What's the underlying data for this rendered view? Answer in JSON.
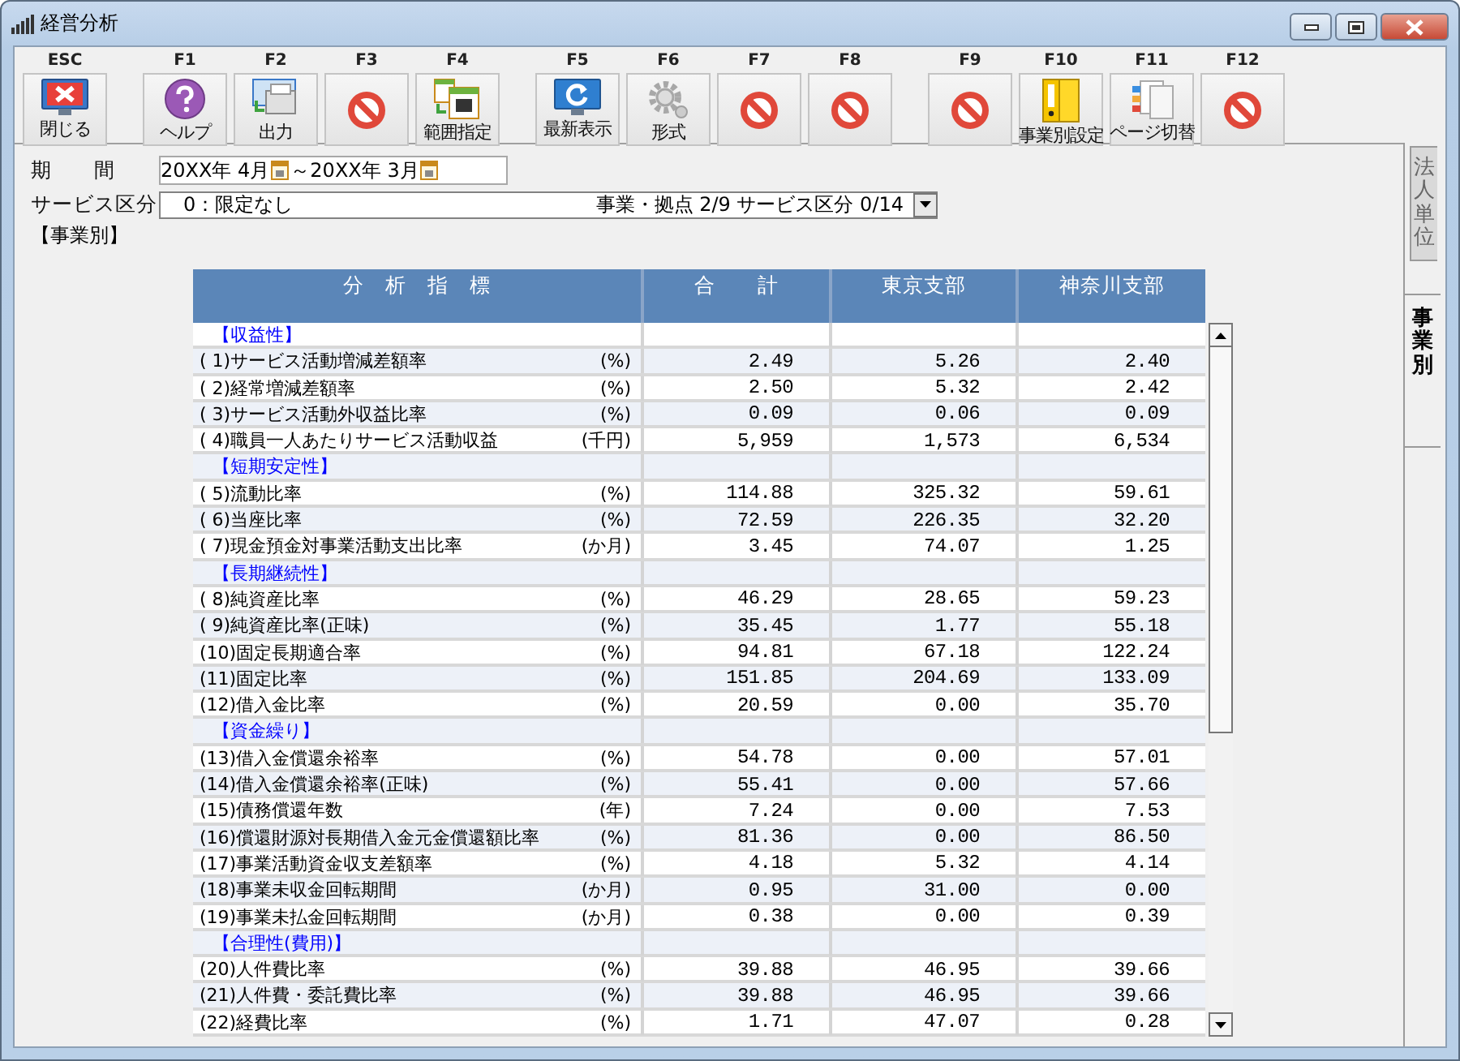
{
  "window": {
    "title": "経営分析"
  },
  "toolbar_groups": [
    [
      {
        "key": "ESC",
        "label": "閉じる",
        "kind": "close"
      }
    ],
    [
      {
        "key": "F1",
        "label": "ヘルプ",
        "kind": "help"
      },
      {
        "key": "F2",
        "label": "出力",
        "kind": "output"
      },
      {
        "key": "F3",
        "kind": "unavailable"
      },
      {
        "key": "F4",
        "label": "範囲指定",
        "kind": "range"
      }
    ],
    [
      {
        "key": "F5",
        "label": "最新表示",
        "kind": "refresh"
      },
      {
        "key": "F6",
        "label": "形式",
        "kind": "format"
      },
      {
        "key": "F7",
        "kind": "unavailable"
      },
      {
        "key": "F8",
        "kind": "unavailable"
      }
    ],
    [
      {
        "key": "F9",
        "kind": "unavailable"
      },
      {
        "key": "F10",
        "label": "事業別設定",
        "kind": "binder"
      },
      {
        "key": "F11",
        "label": "ページ切替",
        "kind": "pages"
      },
      {
        "key": "F12",
        "kind": "unavailable"
      }
    ]
  ],
  "period": {
    "label": "期　　間",
    "from": "20XX年 4月",
    "separator": "～",
    "to": "20XX年 3月"
  },
  "service": {
    "label": "サービス区分",
    "value": "0：限定なし",
    "summary": "事業・拠点 2/9 サービス区分 0/14"
  },
  "section_label": "【事業別】",
  "table": {
    "columns": [
      "分　析　指　標",
      "合　　計",
      "東京支部",
      "神奈川支部"
    ],
    "rows": [
      {
        "kind": "category",
        "label": "【収益性】"
      },
      {
        "kind": "metric",
        "label": "( 1)サービス活動増減差額率",
        "unit": "(%)",
        "values": [
          "2.49",
          "5.26",
          "2.40"
        ]
      },
      {
        "kind": "metric",
        "label": "( 2)経常増減差額率",
        "unit": "(%)",
        "values": [
          "2.50",
          "5.32",
          "2.42"
        ]
      },
      {
        "kind": "metric",
        "label": "( 3)サービス活動外収益比率",
        "unit": "(%)",
        "values": [
          "0.09",
          "0.06",
          "0.09"
        ]
      },
      {
        "kind": "metric",
        "label": "( 4)職員一人あたりサービス活動収益",
        "unit": "(千円)",
        "values": [
          "5,959",
          "1,573",
          "6,534"
        ]
      },
      {
        "kind": "category",
        "label": "【短期安定性】"
      },
      {
        "kind": "metric",
        "label": "( 5)流動比率",
        "unit": "(%)",
        "values": [
          "114.88",
          "325.32",
          "59.61"
        ]
      },
      {
        "kind": "metric",
        "label": "( 6)当座比率",
        "unit": "(%)",
        "values": [
          "72.59",
          "226.35",
          "32.20"
        ]
      },
      {
        "kind": "metric",
        "label": "( 7)現金預金対事業活動支出比率",
        "unit": "(か月)",
        "values": [
          "3.45",
          "74.07",
          "1.25"
        ]
      },
      {
        "kind": "category",
        "label": "【長期継続性】"
      },
      {
        "kind": "metric",
        "label": "( 8)純資産比率",
        "unit": "(%)",
        "values": [
          "46.29",
          "28.65",
          "59.23"
        ]
      },
      {
        "kind": "metric",
        "label": "( 9)純資産比率(正味)",
        "unit": "(%)",
        "values": [
          "35.45",
          "1.77",
          "55.18"
        ]
      },
      {
        "kind": "metric",
        "label": "(10)固定長期適合率",
        "unit": "(%)",
        "values": [
          "94.81",
          "67.18",
          "122.24"
        ]
      },
      {
        "kind": "metric",
        "label": "(11)固定比率",
        "unit": "(%)",
        "values": [
          "151.85",
          "204.69",
          "133.09"
        ]
      },
      {
        "kind": "metric",
        "label": "(12)借入金比率",
        "unit": "(%)",
        "values": [
          "20.59",
          "0.00",
          "35.70"
        ]
      },
      {
        "kind": "category",
        "label": "【資金繰り】"
      },
      {
        "kind": "metric",
        "label": "(13)借入金償還余裕率",
        "unit": "(%)",
        "values": [
          "54.78",
          "0.00",
          "57.01"
        ]
      },
      {
        "kind": "metric",
        "label": "(14)借入金償還余裕率(正味)",
        "unit": "(%)",
        "values": [
          "55.41",
          "0.00",
          "57.66"
        ]
      },
      {
        "kind": "metric",
        "label": "(15)債務償還年数",
        "unit": "(年)",
        "values": [
          "7.24",
          "0.00",
          "7.53"
        ]
      },
      {
        "kind": "metric",
        "label": "(16)償還財源対長期借入金元金償還額比率",
        "unit": "(%)",
        "values": [
          "81.36",
          "0.00",
          "86.50"
        ]
      },
      {
        "kind": "metric",
        "label": "(17)事業活動資金収支差額率",
        "unit": "(%)",
        "values": [
          "4.18",
          "5.32",
          "4.14"
        ]
      },
      {
        "kind": "metric",
        "label": "(18)事業未収金回転期間",
        "unit": "(か月)",
        "values": [
          "0.95",
          "31.00",
          "0.00"
        ]
      },
      {
        "kind": "metric",
        "label": "(19)事業未払金回転期間",
        "unit": "(か月)",
        "values": [
          "0.38",
          "0.00",
          "0.39"
        ]
      },
      {
        "kind": "category",
        "label": "【合理性(費用)】"
      },
      {
        "kind": "metric",
        "label": "(20)人件費比率",
        "unit": "(%)",
        "values": [
          "39.88",
          "46.95",
          "39.66"
        ]
      },
      {
        "kind": "metric",
        "label": "(21)人件費・委託費比率",
        "unit": "(%)",
        "values": [
          "39.88",
          "46.95",
          "39.66"
        ]
      },
      {
        "kind": "metric",
        "label": "(22)経費比率",
        "unit": "(%)",
        "values": [
          "1.71",
          "47.07",
          "0.28"
        ]
      }
    ]
  },
  "side_tabs": [
    {
      "label": "法人単位",
      "selected": false
    },
    {
      "label": "事業別",
      "selected": true
    }
  ]
}
